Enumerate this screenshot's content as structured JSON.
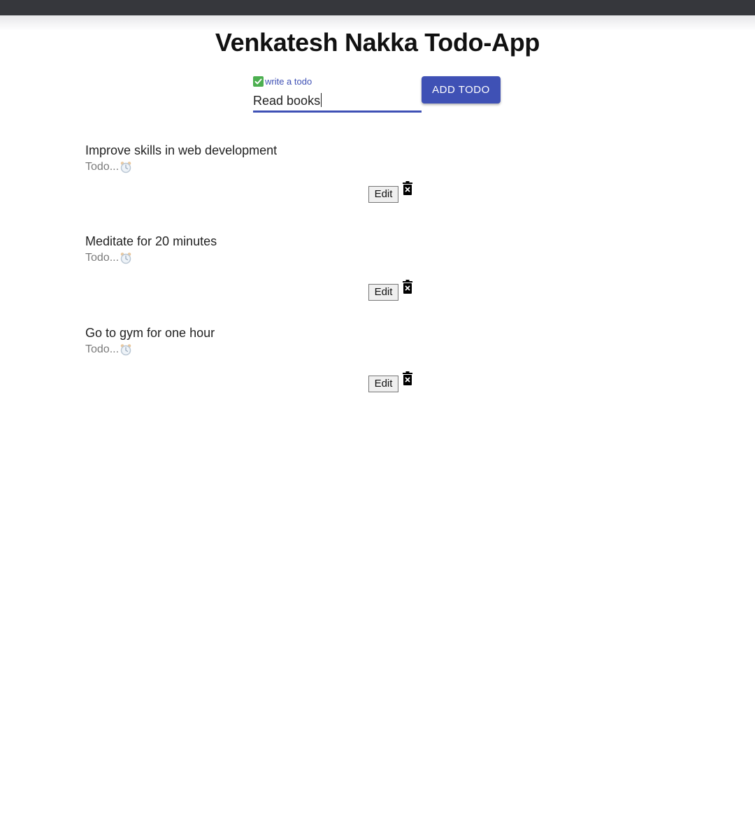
{
  "app": {
    "title": "Venkatesh Nakka Todo-App"
  },
  "form": {
    "label": "write a todo",
    "label_icon": "check-mark-icon",
    "input_value": "Read books",
    "add_button_label": "ADD TODO"
  },
  "todos": [
    {
      "title": "Improve skills in web development",
      "status": "Todo...",
      "status_icon": "alarm-clock-icon",
      "edit_label": "Edit",
      "delete_icon": "trash-icon"
    },
    {
      "title": "Meditate for 20 minutes",
      "status": "Todo...",
      "status_icon": "alarm-clock-icon",
      "edit_label": "Edit",
      "delete_icon": "trash-icon"
    },
    {
      "title": "Go to gym for one hour",
      "status": "Todo...",
      "status_icon": "alarm-clock-icon",
      "edit_label": "Edit",
      "delete_icon": "trash-icon"
    }
  ],
  "colors": {
    "accent": "#3f51b5",
    "top_bar": "#36373c",
    "check_green": "#4caf50"
  }
}
